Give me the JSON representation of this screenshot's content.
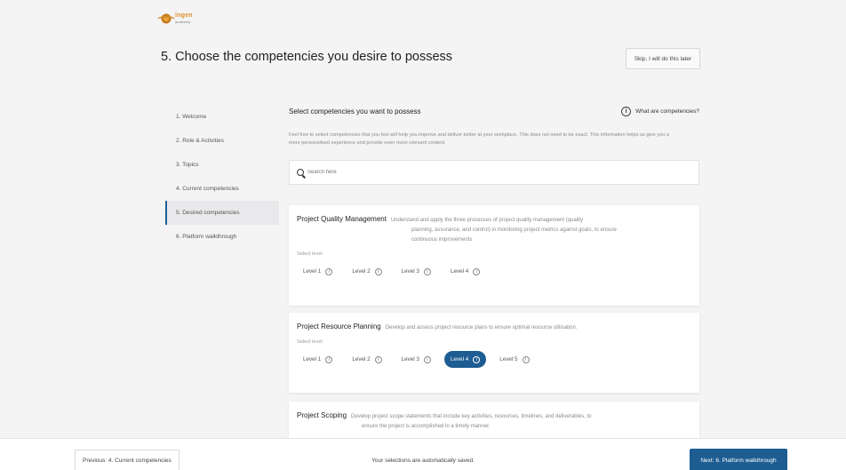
{
  "header": {
    "logo_text": "ingen",
    "logo_sub": "academy",
    "page_title": "5. Choose the competencies you desire to possess",
    "skip_label": "Skip, I will do this later"
  },
  "sidebar": {
    "items": [
      {
        "label": "1. Welcome"
      },
      {
        "label": "2. Role & Activities"
      },
      {
        "label": "3. Topics"
      },
      {
        "label": "4. Current competencies"
      },
      {
        "label": "5. Desired competencies"
      },
      {
        "label": "6. Platform walkthrough"
      }
    ]
  },
  "main": {
    "section_title": "Select competencies you want to possess",
    "what_label": "What are competencies?",
    "intro": "Feel free to select competencies that you feel will help you improve and deliver better at your workplace. This does not need to be exact. This information helps us give you a more personalised experience and provide even more relevant content.",
    "search_placeholder": "Search here",
    "select_level_label": "Select level",
    "cards": [
      {
        "title": "Project Quality Management",
        "desc1": "Understand and apply the three processes of project quality management (quality",
        "desc2": "planning, assurance, and control) in monitoring project metrics against goals, to ensure",
        "desc3": "continuous improvements",
        "levels": [
          "Level 1",
          "Level 2",
          "Level 3",
          "Level 4"
        ]
      },
      {
        "title": "Project Resource Planning",
        "desc1": "Develop and assess project resource plans to ensure optimal resource utilisation.",
        "levels": [
          "Level 1",
          "Level 2",
          "Level 3",
          "Level 4",
          "Level 5"
        ],
        "selected_level": "Level 4"
      },
      {
        "title": "Project Scoping",
        "desc1": "Develop project scope statements that include key activities, resources, timelines, and deliverables, to",
        "desc2": "ensure the project is accomplished in a timely manner."
      }
    ]
  },
  "footer": {
    "prev_label": "Previous: 4. Current competencies",
    "autosave_text": "Your selections are automatically saved.",
    "next_label": "Next: 6. Platform walkthrough"
  },
  "colors": {
    "accent": "#1e5d92",
    "logo": "#e0902c"
  },
  "icons": {
    "info": "info-icon",
    "search": "search-icon"
  }
}
